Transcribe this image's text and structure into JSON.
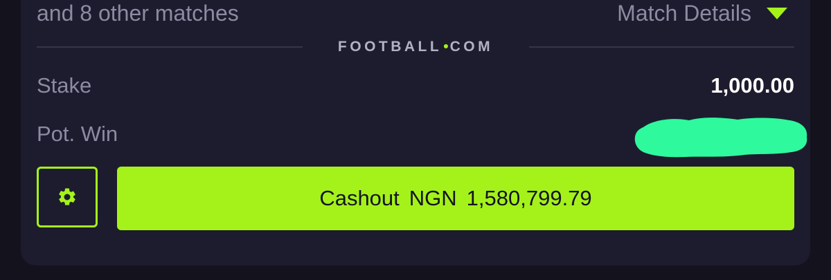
{
  "bet": {
    "matches_text": "and 8 other matches",
    "details_label": "Match Details"
  },
  "brand": {
    "left": "FOOTBALL",
    "dot": "•",
    "right": "COM"
  },
  "stake": {
    "label": "Stake",
    "value": "1,000.00"
  },
  "pot_win": {
    "label": "Pot. Win",
    "value_hidden": true
  },
  "cashout": {
    "label": "Cashout",
    "currency": "NGN",
    "amount": "1,580,799.79"
  },
  "colors": {
    "accent": "#a5f21a",
    "redaction": "#2ef99d",
    "card_bg": "#1d1c2e",
    "page_bg": "#13121d"
  },
  "icons": {
    "details": "triangle-down-icon",
    "settings": "gear-icon"
  }
}
